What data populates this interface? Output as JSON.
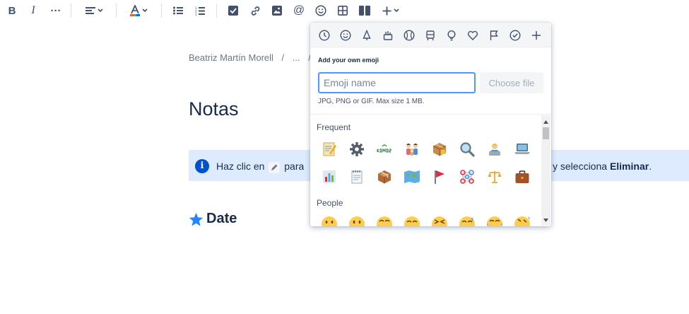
{
  "breadcrumb": {
    "parts": [
      "Beatriz Martín Morell",
      "/",
      "...",
      "/"
    ]
  },
  "page": {
    "title": "Notas",
    "info_left": "Haz clic en",
    "info_left_after": "para",
    "info_right_prefix": "y selecciona",
    "info_right_bold": "Eliminar",
    "info_right_suffix": ".",
    "date_heading": "Date"
  },
  "picker": {
    "upload_title": "Add your own emoji",
    "input_placeholder": "Emoji name",
    "choose_file": "Choose file",
    "hint": "JPG, PNG or GIF. Max size 1 MB.",
    "sections": [
      "Frequent",
      "People"
    ],
    "categories": [
      "clock-icon",
      "smiley-icon",
      "nature-icon",
      "food-icon",
      "activity-icon",
      "travel-icon",
      "objects-icon",
      "symbols-icon",
      "flags-icon",
      "productivity-icon",
      "add-icon"
    ]
  },
  "colors": {
    "accent": "#0052cc",
    "focus": "#4c9aff",
    "panel": "#deebff",
    "star": "#2684ff"
  }
}
